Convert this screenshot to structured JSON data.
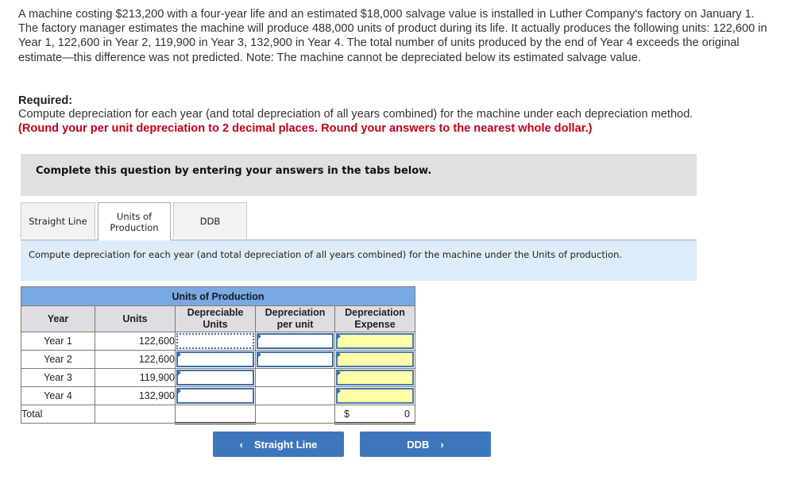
{
  "problem": {
    "text": "A machine costing $213,200 with a four-year life and an estimated $18,000 salvage value is installed in Luther Company's factory on January 1. The factory manager estimates the machine will produce 488,000 units of product during its life. It actually produces the following units: 122,600 in Year 1, 122,600 in Year 2, 119,900 in Year 3, 132,900 in Year 4. The total number of units produced by the end of Year 4 exceeds the original estimate—this difference was not predicted. Note: The machine cannot be depreciated below its estimated salvage value."
  },
  "required": {
    "label": "Required:",
    "text": "Compute depreciation for each year (and total depreciation of all years combined) for the machine under each depreciation method.",
    "note": "(Round your per unit depreciation to 2 decimal places. Round your answers to the nearest whole dollar.)"
  },
  "banner": "Complete this question by entering your answers in the tabs below.",
  "tabs": [
    {
      "label": "Straight Line",
      "active": false
    },
    {
      "label": "Units of Production",
      "active": true
    },
    {
      "label": "DDB",
      "active": false
    }
  ],
  "instructions": "Compute depreciation for each year (and total depreciation of all years combined) for the machine under the Units of production.",
  "table": {
    "title": "Units of Production",
    "headers": [
      "Year",
      "Units",
      "Depreciable Units",
      "Depreciation per unit",
      "Depreciation Expense"
    ],
    "rows": [
      {
        "year": "Year 1",
        "units": "122,600",
        "depreciable_units": "",
        "per_unit": "",
        "expense": ""
      },
      {
        "year": "Year 2",
        "units": "122,600",
        "depreciable_units": "",
        "per_unit": "",
        "expense": ""
      },
      {
        "year": "Year 3",
        "units": "119,900",
        "depreciable_units": "",
        "per_unit": "",
        "expense": ""
      },
      {
        "year": "Year 4",
        "units": "132,900",
        "depreciable_units": "",
        "per_unit": "",
        "expense": ""
      }
    ],
    "total": {
      "label": "Total",
      "currency": "$",
      "expense": "0"
    }
  },
  "nav": {
    "prev_label": "Straight Line",
    "next_label": "DDB",
    "prev_icon": "‹",
    "next_icon": "›"
  },
  "colors": {
    "accent": "#3d76bb",
    "required_note": "#c0001a",
    "table_title": "#78a9e2",
    "input_highlight": "#ffffa8",
    "instructions_bg": "#dcecf8"
  }
}
